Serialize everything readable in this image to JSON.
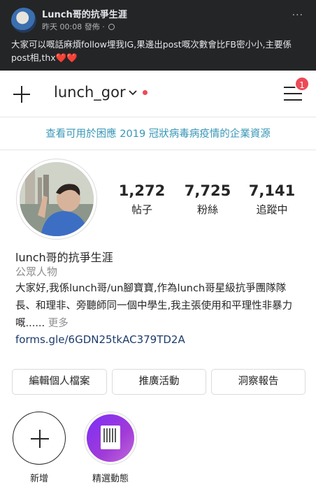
{
  "fb_post": {
    "author": "Lunch哥的抗爭生涯",
    "time": "昨天 00:08",
    "posted_label": "發佈 ·",
    "more_label": "···",
    "text": "大家可以嘅話麻煩follow埋我IG,果邊出post嘅次數會比FB密小小,主要係post相,thx",
    "hearts": "❤️❤️"
  },
  "ig": {
    "username": "lunch_gor",
    "notification_count": "1",
    "covid_banner": "查看可用於困應 2019 冠狀病毒病疫情的企業資源",
    "stats": [
      {
        "value": "1,272",
        "label": "帖子"
      },
      {
        "value": "7,725",
        "label": "粉絲"
      },
      {
        "value": "7,141",
        "label": "追蹤中"
      }
    ],
    "display_name": "lunch哥的抗爭生涯",
    "category": "公眾人物",
    "bio": "大家好,我係lunch哥/un腳寶寶,作為lunch哥星級抗爭團隊隊長、和理非、旁聽師同一個中學生,我主張使用和平理性非暴力嘅......",
    "more": "更多",
    "link": "forms.gle/6GDN25tkAC379TD2A",
    "buttons": [
      "編輯個人檔案",
      "推廣活動",
      "洞察報告"
    ],
    "highlights": [
      {
        "label": "新增"
      },
      {
        "label": "精選動態"
      }
    ]
  }
}
